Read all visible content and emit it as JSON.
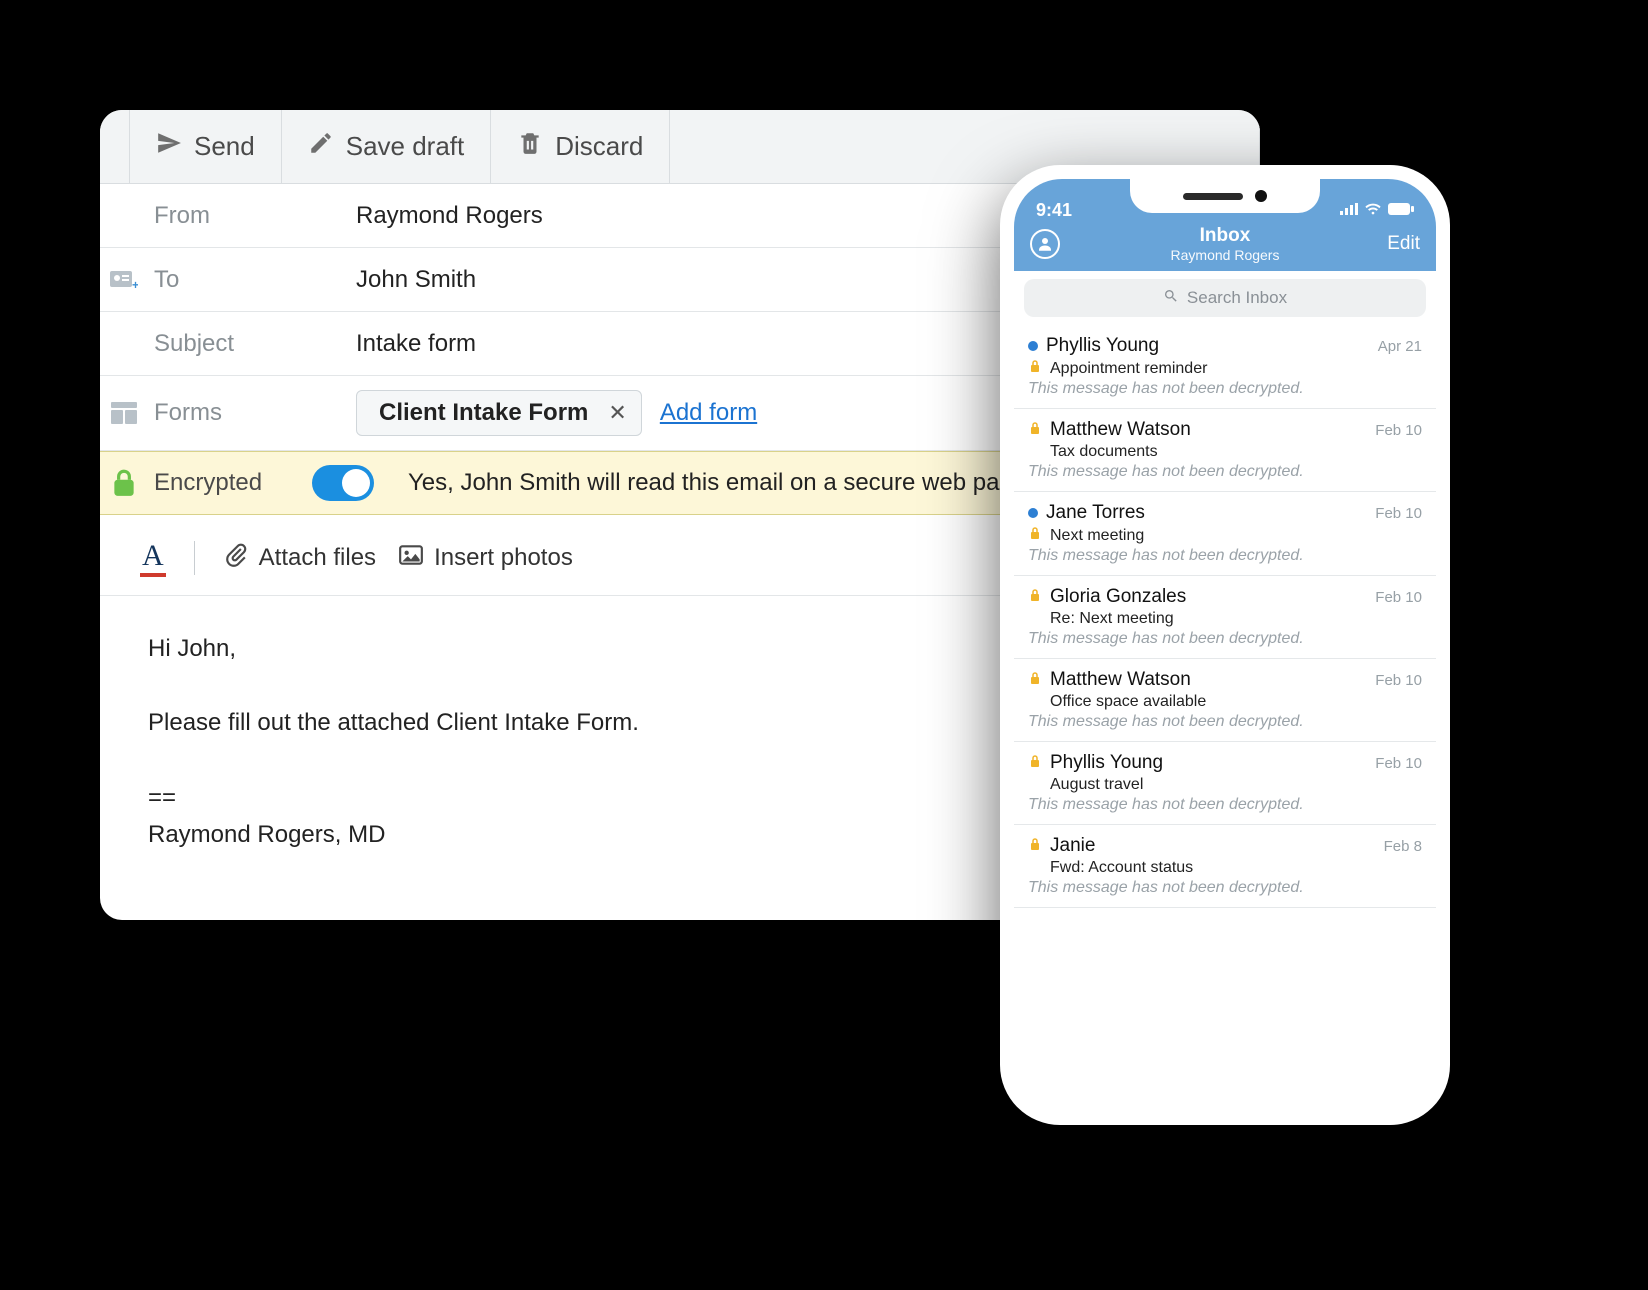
{
  "compose": {
    "toolbar": {
      "send": "Send",
      "save_draft": "Save draft",
      "discard": "Discard"
    },
    "from_label": "From",
    "from_value": "Raymond Rogers",
    "to_label": "To",
    "to_value": "John Smith",
    "subject_label": "Subject",
    "subject_value": "Intake form",
    "forms_label": "Forms",
    "form_chip": "Client Intake Form",
    "add_form": "Add form",
    "encrypted_label": "Encrypted",
    "encrypted_text": "Yes, John Smith will read this email on a secure web pa",
    "editbar": {
      "attach": "Attach files",
      "insert_photos": "Insert photos"
    },
    "body_lines": [
      "Hi John,",
      "",
      "Please fill out the attached Client Intake Form.",
      "",
      "==",
      "Raymond Rogers, MD"
    ]
  },
  "phone": {
    "time": "9:41",
    "nav_title": "Inbox",
    "nav_subtitle": "Raymond Rogers",
    "nav_edit": "Edit",
    "search_placeholder": "Search Inbox",
    "preview_text": "This message has not been decrypted.",
    "messages": [
      {
        "unread": true,
        "name": "Phyllis Young",
        "date": "Apr 21",
        "subject": "Appointment reminder"
      },
      {
        "unread": false,
        "name": "Matthew Watson",
        "date": "Feb 10",
        "subject": "Tax documents"
      },
      {
        "unread": true,
        "name": "Jane Torres",
        "date": "Feb 10",
        "subject": "Next meeting"
      },
      {
        "unread": false,
        "name": "Gloria Gonzales",
        "date": "Feb 10",
        "subject": "Re: Next meeting"
      },
      {
        "unread": false,
        "name": "Matthew Watson",
        "date": "Feb 10",
        "subject": "Office space available"
      },
      {
        "unread": false,
        "name": "Phyllis Young",
        "date": "Feb 10",
        "subject": "August travel"
      },
      {
        "unread": false,
        "name": "Janie",
        "date": "Feb 8",
        "subject": "Fwd: Account status"
      }
    ]
  }
}
